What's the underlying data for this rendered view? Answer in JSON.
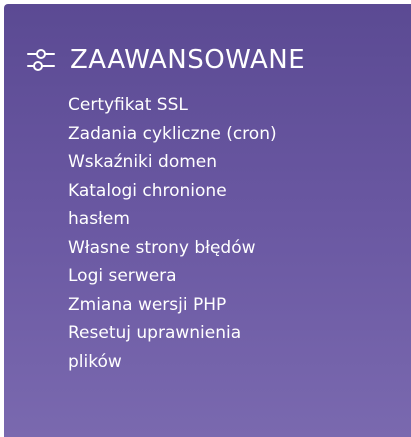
{
  "section": {
    "icon": "sliders-icon",
    "title": "ZAAWANSOWANE"
  },
  "menu": {
    "items": [
      {
        "label": "Certyfikat SSL"
      },
      {
        "label": "Zadania cykliczne (cron)"
      },
      {
        "label": "Wskaźniki domen"
      },
      {
        "label": "Katalogi chronione hasłem"
      },
      {
        "label": "Własne strony błędów"
      },
      {
        "label": "Logi serwera"
      },
      {
        "label": "Zmiana wersji PHP"
      },
      {
        "label": "Resetuj uprawnienia plików"
      }
    ]
  },
  "colors": {
    "panel_top": "#5b4a93",
    "panel_bottom": "#7a69af",
    "text": "#ffffff"
  }
}
